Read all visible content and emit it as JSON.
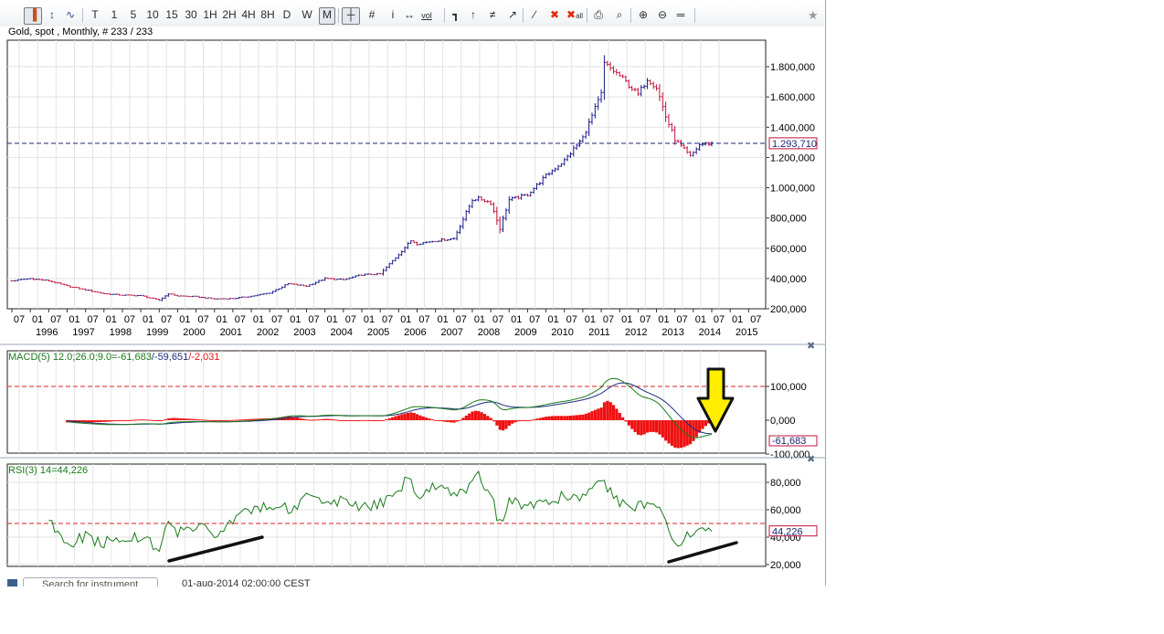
{
  "toolbar": {
    "buttons": [
      "T",
      "1",
      "5",
      "10",
      "15",
      "30",
      "1H",
      "2H",
      "4H",
      "8H",
      "D",
      "W",
      "M"
    ],
    "selected": "M",
    "vol_label": "vol",
    "all_label": "all"
  },
  "chart_info": "Gold, spot , Monthly, # 233 / 233",
  "price_panel": {
    "current_value": 1293710,
    "current_label": "1.293,710",
    "y_ticks": [
      {
        "v": 1800000,
        "label": "1.800,000"
      },
      {
        "v": 1600000,
        "label": "1.600,000"
      },
      {
        "v": 1400000,
        "label": "1.400,000"
      },
      {
        "v": 1200000,
        "label": "1.200,000"
      },
      {
        "v": 1000000,
        "label": "1.000,000"
      },
      {
        "v": 800000,
        "label": "800,000"
      },
      {
        "v": 600000,
        "label": "600,000"
      },
      {
        "v": 400000,
        "label": "400,000"
      },
      {
        "v": 200000,
        "label": "200,000"
      }
    ],
    "x_month_labels": [
      "07",
      "01",
      "07",
      "01",
      "07",
      "01",
      "07",
      "01",
      "07",
      "01",
      "07",
      "01",
      "07",
      "01",
      "07",
      "01",
      "07",
      "01",
      "07",
      "01",
      "07",
      "01",
      "07",
      "01",
      "07",
      "01",
      "07",
      "01",
      "07",
      "01",
      "07",
      "01",
      "07",
      "01",
      "07",
      "01",
      "07",
      "01",
      "07",
      "01",
      "07"
    ],
    "x_year_labels": [
      "1996",
      "1997",
      "1998",
      "1999",
      "2000",
      "2001",
      "2002",
      "2003",
      "2004",
      "2005",
      "2006",
      "2007",
      "2008",
      "2009",
      "2010",
      "2011",
      "2012",
      "2013",
      "2014",
      "2015"
    ]
  },
  "macd_panel": {
    "label": "MACD(5) 12.0;26.0;9.0=",
    "macd_value": "-61,683",
    "signal_value": "-59,651",
    "hist_value": "-2,031",
    "separator": "/",
    "current_label": "-61,683",
    "y_ticks": [
      {
        "v": 100000,
        "label": "100,000"
      },
      {
        "v": 0,
        "label": "0,000"
      },
      {
        "v": -100000,
        "label": "-100,000"
      }
    ],
    "colors": {
      "macd": "#1a7a1a",
      "signal": "#1b2d80",
      "hist": "#ee1111"
    }
  },
  "rsi_panel": {
    "label": "RSI(3) 14=44,226",
    "current_label": "44,226",
    "y_ticks": [
      {
        "v": 80,
        "label": "80,000"
      },
      {
        "v": 60,
        "label": "60,000"
      },
      {
        "v": 40,
        "label": "40,000"
      },
      {
        "v": 20,
        "label": "20,000"
      }
    ],
    "color": "#1a7a1a"
  },
  "statusbar": {
    "search_placeholder": "Search for instrument",
    "date_text": "01-aug-2014 02:00:00 CEST"
  },
  "chart_data": [
    {
      "type": "ohlc",
      "title": "Gold, spot , Monthly, # 233 / 233",
      "x_start": "1995-07",
      "x_end": "2014-07",
      "ylim": [
        200000,
        1900000
      ],
      "reference_line": 1293710,
      "close_anchors": [
        [
          "1995-07",
          385000
        ],
        [
          "1996-01",
          400000
        ],
        [
          "1996-07",
          385000
        ],
        [
          "1997-01",
          350000
        ],
        [
          "1997-07",
          325000
        ],
        [
          "1998-01",
          300000
        ],
        [
          "1998-07",
          290000
        ],
        [
          "1999-01",
          287000
        ],
        [
          "1999-07",
          256000
        ],
        [
          "1999-10",
          300000
        ],
        [
          "2000-01",
          285000
        ],
        [
          "2000-07",
          280000
        ],
        [
          "2001-01",
          265000
        ],
        [
          "2001-07",
          268000
        ],
        [
          "2002-01",
          283000
        ],
        [
          "2002-07",
          305000
        ],
        [
          "2003-01",
          365000
        ],
        [
          "2003-07",
          350000
        ],
        [
          "2004-01",
          400000
        ],
        [
          "2004-07",
          392000
        ],
        [
          "2005-01",
          425000
        ],
        [
          "2005-07",
          430000
        ],
        [
          "2006-01",
          560000
        ],
        [
          "2006-05",
          650000
        ],
        [
          "2006-07",
          630000
        ],
        [
          "2007-01",
          650000
        ],
        [
          "2007-07",
          665000
        ],
        [
          "2008-01",
          920000
        ],
        [
          "2008-03",
          930000
        ],
        [
          "2008-07",
          900000
        ],
        [
          "2008-10",
          730000
        ],
        [
          "2009-01",
          920000
        ],
        [
          "2009-07",
          955000
        ],
        [
          "2010-01",
          1080000
        ],
        [
          "2010-07",
          1180000
        ],
        [
          "2011-01",
          1330000
        ],
        [
          "2011-07",
          1620000
        ],
        [
          "2011-08",
          1820000
        ],
        [
          "2012-01",
          1740000
        ],
        [
          "2012-07",
          1615000
        ],
        [
          "2012-10",
          1720000
        ],
        [
          "2013-01",
          1665000
        ],
        [
          "2013-04",
          1470000
        ],
        [
          "2013-07",
          1320000
        ],
        [
          "2013-12",
          1205000
        ],
        [
          "2014-03",
          1285000
        ],
        [
          "2014-07",
          1293710
        ]
      ]
    },
    {
      "type": "line",
      "title": "MACD(5) 12.0;26.0;9.0",
      "ylim": [
        -200000,
        200000
      ],
      "series": [
        {
          "name": "MACD"
        },
        {
          "name": "Signal"
        }
      ],
      "histogram": "MACD - Signal",
      "reference_line": 100000,
      "last_values": {
        "macd": -61683,
        "signal": -59651,
        "hist": -2031
      }
    },
    {
      "type": "line",
      "title": "RSI(3) 14",
      "ylim": [
        20,
        90
      ],
      "reference_line": 50,
      "last_value": 44.226,
      "x_start": "1996-07",
      "rsi_anchors": [
        [
          "1996-07",
          51
        ],
        [
          "1997-01",
          35
        ],
        [
          "1997-07",
          40
        ],
        [
          "1998-01",
          36
        ],
        [
          "1998-07",
          40
        ],
        [
          "1999-01",
          38
        ],
        [
          "1999-07",
          33
        ],
        [
          "1999-10",
          52
        ],
        [
          "2000-01",
          44
        ],
        [
          "2000-07",
          47
        ],
        [
          "2001-01",
          43
        ],
        [
          "2001-07",
          52
        ],
        [
          "2002-01",
          60
        ],
        [
          "2002-07",
          65
        ],
        [
          "2003-01",
          61
        ],
        [
          "2003-07",
          68
        ],
        [
          "2004-01",
          63
        ],
        [
          "2004-07",
          66
        ],
        [
          "2005-01",
          62
        ],
        [
          "2005-07",
          65
        ],
        [
          "2006-01",
          75
        ],
        [
          "2006-05",
          85
        ],
        [
          "2006-07",
          70
        ],
        [
          "2007-01",
          78
        ],
        [
          "2007-07",
          73
        ],
        [
          "2008-01",
          77
        ],
        [
          "2008-03",
          86
        ],
        [
          "2008-07",
          71
        ],
        [
          "2008-10",
          49
        ],
        [
          "2009-01",
          67
        ],
        [
          "2009-07",
          62
        ],
        [
          "2010-01",
          65
        ],
        [
          "2010-07",
          71
        ],
        [
          "2011-01",
          70
        ],
        [
          "2011-07",
          78
        ],
        [
          "2011-08",
          80
        ],
        [
          "2012-01",
          66
        ],
        [
          "2012-07",
          62
        ],
        [
          "2012-10",
          66
        ],
        [
          "2013-01",
          60
        ],
        [
          "2013-04",
          53
        ],
        [
          "2013-07",
          36
        ],
        [
          "2013-12",
          41
        ],
        [
          "2014-03",
          48
        ],
        [
          "2014-07",
          44.226
        ]
      ]
    }
  ]
}
